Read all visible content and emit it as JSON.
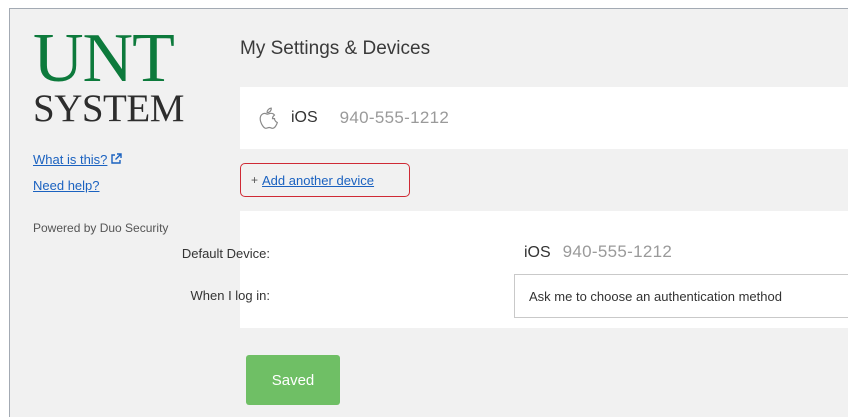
{
  "sidebar": {
    "logo_line1": "UNT",
    "logo_line2": "SYSTEM",
    "logo_mark": "·",
    "what_is_this": "What is this?",
    "need_help": "Need help?",
    "powered_by": "Powered by Duo Security",
    "external_icon": "external-link-icon"
  },
  "main": {
    "title": "My Settings & Devices",
    "device": {
      "icon": "apple-icon",
      "os": "iOS",
      "phone": "940-555-1212"
    },
    "add_device": {
      "plus": "+",
      "label": "Add another device",
      "highlight_color": "#cf2a35"
    },
    "defaults": {
      "default_device_label": "Default Device:",
      "default_device_os": "iOS",
      "default_device_phone": "940-555-1212",
      "login_label": "When I log in:",
      "login_value": "Ask me to choose an authentication method"
    },
    "saved_button": "Saved"
  },
  "colors": {
    "brand_green": "#0d7a3c",
    "link_blue": "#1b62c0",
    "saved_green": "#6fbf65",
    "background": "#f1f1f1"
  }
}
